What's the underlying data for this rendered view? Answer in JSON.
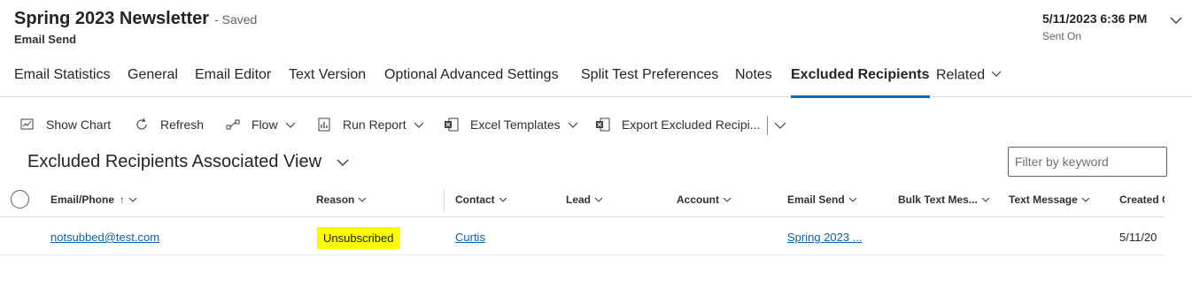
{
  "header": {
    "title": "Spring 2023 Newsletter",
    "saved_status": "- Saved",
    "entity": "Email Send",
    "sent_on_value": "5/11/2023 6:36 PM",
    "sent_on_label": "Sent On"
  },
  "tabs": [
    {
      "label": "Email Statistics"
    },
    {
      "label": "General"
    },
    {
      "label": "Email Editor"
    },
    {
      "label": "Text Version"
    },
    {
      "label": "Optional Advanced Settings"
    },
    {
      "label": "Split Test Preferences"
    },
    {
      "label": "Notes"
    },
    {
      "label": "Excluded Recipients",
      "active": true
    },
    {
      "label": "Related"
    }
  ],
  "commands": {
    "show_chart": "Show Chart",
    "refresh": "Refresh",
    "flow": "Flow",
    "run_report": "Run Report",
    "excel_templates": "Excel Templates",
    "export": "Export Excluded Recipi..."
  },
  "view": {
    "title": "Excluded Recipients Associated View",
    "filter_placeholder": "Filter by keyword"
  },
  "grid": {
    "columns": {
      "email": "Email/Phone",
      "sort_arrow": "↑",
      "reason": "Reason",
      "contact": "Contact",
      "lead": "Lead",
      "account": "Account",
      "email_send": "Email Send",
      "bulk_text": "Bulk Text Mes...",
      "text_message": "Text Message",
      "created": "Created C"
    },
    "rows": [
      {
        "email": "notsubbed@test.com",
        "reason": "Unsubscribed",
        "contact": "Curtis",
        "email_send": "Spring 2023 ...",
        "created": "5/11/20"
      }
    ]
  },
  "colors": {
    "accent": "#0f6cbd",
    "link": "#115ea3",
    "highlight": "#fdff00"
  },
  "icons": [
    "chevron-down-icon",
    "chart-icon",
    "refresh-icon",
    "flow-icon",
    "report-icon",
    "excel-icon",
    "export-excel-icon"
  ]
}
